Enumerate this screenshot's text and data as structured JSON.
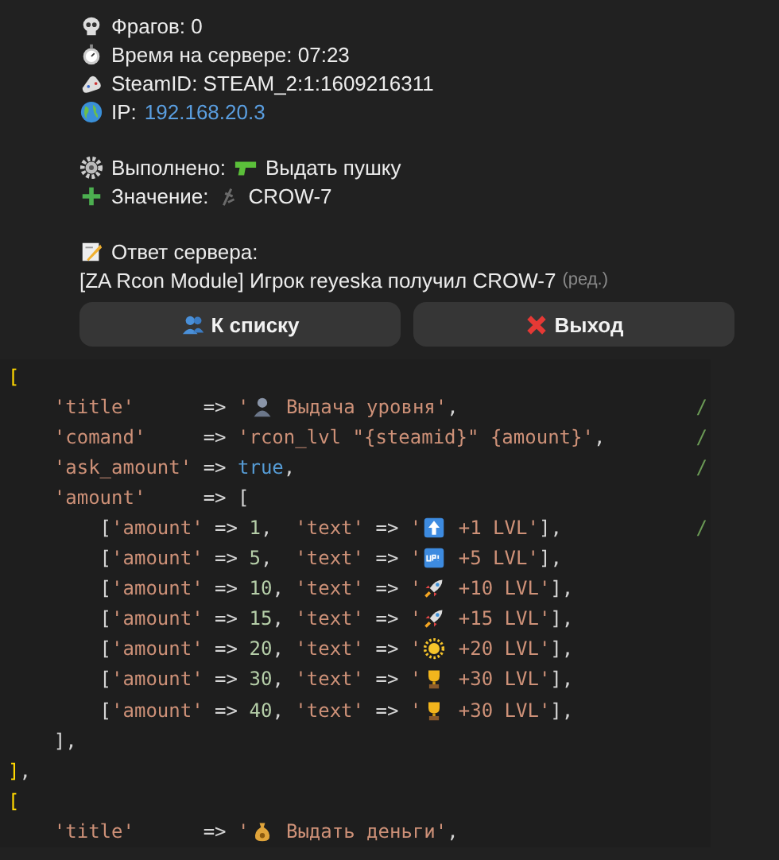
{
  "info_lines": [
    {
      "label": "Фрагов: 0"
    },
    {
      "label": "Время на сервере: 07:23"
    },
    {
      "label": "SteamID: STEAM_2:1:1609216311"
    },
    {
      "label": "IP:",
      "link": "192.168.20.3"
    }
  ],
  "action": {
    "label": "Выполнено:",
    "value": "Выдать пушку"
  },
  "value_line": {
    "label": "Значение:",
    "value": "CROW-7"
  },
  "response": {
    "label": "Ответ сервера:",
    "text": "[ZA Rcon Module] Игрок reyeska получил CROW-7",
    "edited": "(ред.)"
  },
  "buttons": [
    {
      "label": "К списку"
    },
    {
      "label": "Выход"
    }
  ],
  "code": {
    "lines": [
      {
        "tokens": [
          {
            "kind": "outer",
            "text": "["
          }
        ]
      },
      {
        "tokens": [
          {
            "kind": "str",
            "text": "    'title'"
          },
          {
            "kind": "op",
            "text": "      => "
          },
          {
            "kind": "str",
            "text": "'"
          },
          {
            "kind": "emoji"
          },
          {
            "kind": "str",
            "text": " Выдача уровня'"
          },
          {
            "kind": "op",
            "text": ","
          }
        ],
        "comment": "/"
      },
      {
        "tokens": [
          {
            "kind": "str",
            "text": "    'comand'"
          },
          {
            "kind": "op",
            "text": "     => "
          },
          {
            "kind": "str",
            "text": "'rcon_lvl \"{steamid}\" {amount}'"
          },
          {
            "kind": "op",
            "text": ","
          }
        ],
        "comment": "/"
      },
      {
        "tokens": [
          {
            "kind": "str",
            "text": "    'ask_amount'"
          },
          {
            "kind": "op",
            "text": " => "
          },
          {
            "kind": "kw",
            "text": "true"
          },
          {
            "kind": "op",
            "text": ","
          }
        ],
        "comment": "/"
      },
      {
        "tokens": [
          {
            "kind": "str",
            "text": "    'amount'"
          },
          {
            "kind": "op",
            "text": "     => "
          },
          {
            "kind": "inner",
            "text": "["
          }
        ]
      },
      {
        "tokens": [
          {
            "kind": "inner",
            "text": "        ["
          },
          {
            "kind": "str",
            "text": "'amount'"
          },
          {
            "kind": "op",
            "text": " => "
          },
          {
            "kind": "num",
            "text": "1"
          },
          {
            "kind": "op",
            "text": ",  "
          },
          {
            "kind": "str",
            "text": "'text'"
          },
          {
            "kind": "op",
            "text": " => "
          },
          {
            "kind": "str",
            "text": "'"
          },
          {
            "kind": "emoji"
          },
          {
            "kind": "str",
            "text": " +1 LVL'"
          },
          {
            "kind": "inner",
            "text": "]"
          },
          {
            "kind": "op",
            "text": ","
          }
        ],
        "comment": "/"
      },
      {
        "tokens": [
          {
            "kind": "inner",
            "text": "        ["
          },
          {
            "kind": "str",
            "text": "'amount'"
          },
          {
            "kind": "op",
            "text": " => "
          },
          {
            "kind": "num",
            "text": "5"
          },
          {
            "kind": "op",
            "text": ",  "
          },
          {
            "kind": "str",
            "text": "'text'"
          },
          {
            "kind": "op",
            "text": " => "
          },
          {
            "kind": "str",
            "text": "'"
          },
          {
            "kind": "emoji"
          },
          {
            "kind": "str",
            "text": " +5 LVL'"
          },
          {
            "kind": "inner",
            "text": "]"
          },
          {
            "kind": "op",
            "text": ","
          }
        ]
      },
      {
        "tokens": [
          {
            "kind": "inner",
            "text": "        ["
          },
          {
            "kind": "str",
            "text": "'amount'"
          },
          {
            "kind": "op",
            "text": " => "
          },
          {
            "kind": "num",
            "text": "10"
          },
          {
            "kind": "op",
            "text": ", "
          },
          {
            "kind": "str",
            "text": "'text'"
          },
          {
            "kind": "op",
            "text": " => "
          },
          {
            "kind": "str",
            "text": "'"
          },
          {
            "kind": "emoji"
          },
          {
            "kind": "str",
            "text": " +10 LVL'"
          },
          {
            "kind": "inner",
            "text": "]"
          },
          {
            "kind": "op",
            "text": ","
          }
        ]
      },
      {
        "tokens": [
          {
            "kind": "inner",
            "text": "        ["
          },
          {
            "kind": "str",
            "text": "'amount'"
          },
          {
            "kind": "op",
            "text": " => "
          },
          {
            "kind": "num",
            "text": "15"
          },
          {
            "kind": "op",
            "text": ", "
          },
          {
            "kind": "str",
            "text": "'text'"
          },
          {
            "kind": "op",
            "text": " => "
          },
          {
            "kind": "str",
            "text": "'"
          },
          {
            "kind": "emoji"
          },
          {
            "kind": "str",
            "text": " +15 LVL'"
          },
          {
            "kind": "inner",
            "text": "]"
          },
          {
            "kind": "op",
            "text": ","
          }
        ]
      },
      {
        "tokens": [
          {
            "kind": "inner",
            "text": "        ["
          },
          {
            "kind": "str",
            "text": "'amount'"
          },
          {
            "kind": "op",
            "text": " => "
          },
          {
            "kind": "num",
            "text": "20"
          },
          {
            "kind": "op",
            "text": ", "
          },
          {
            "kind": "str",
            "text": "'text'"
          },
          {
            "kind": "op",
            "text": " => "
          },
          {
            "kind": "str",
            "text": "'"
          },
          {
            "kind": "emoji"
          },
          {
            "kind": "str",
            "text": " +20 LVL'"
          },
          {
            "kind": "inner",
            "text": "]"
          },
          {
            "kind": "op",
            "text": ","
          }
        ]
      },
      {
        "tokens": [
          {
            "kind": "inner",
            "text": "        ["
          },
          {
            "kind": "str",
            "text": "'amount'"
          },
          {
            "kind": "op",
            "text": " => "
          },
          {
            "kind": "num",
            "text": "30"
          },
          {
            "kind": "op",
            "text": ", "
          },
          {
            "kind": "str",
            "text": "'text'"
          },
          {
            "kind": "op",
            "text": " => "
          },
          {
            "kind": "str",
            "text": "'"
          },
          {
            "kind": "emoji"
          },
          {
            "kind": "str",
            "text": " +30 LVL'"
          },
          {
            "kind": "inner",
            "text": "]"
          },
          {
            "kind": "op",
            "text": ","
          }
        ]
      },
      {
        "tokens": [
          {
            "kind": "inner",
            "text": "        ["
          },
          {
            "kind": "str",
            "text": "'amount'"
          },
          {
            "kind": "op",
            "text": " => "
          },
          {
            "kind": "num",
            "text": "40"
          },
          {
            "kind": "op",
            "text": ", "
          },
          {
            "kind": "str",
            "text": "'text'"
          },
          {
            "kind": "op",
            "text": " => "
          },
          {
            "kind": "str",
            "text": "'"
          },
          {
            "kind": "emoji"
          },
          {
            "kind": "str",
            "text": " +30 LVL'"
          },
          {
            "kind": "inner",
            "text": "]"
          },
          {
            "kind": "op",
            "text": ","
          }
        ]
      },
      {
        "tokens": [
          {
            "kind": "inner",
            "text": "    ]"
          },
          {
            "kind": "op",
            "text": ","
          }
        ]
      },
      {
        "tokens": [
          {
            "kind": "outer",
            "text": "]"
          },
          {
            "kind": "op",
            "text": ","
          }
        ]
      },
      {
        "tokens": [
          {
            "kind": "outer",
            "text": "["
          }
        ]
      },
      {
        "tokens": [
          {
            "kind": "str",
            "text": "    'title'"
          },
          {
            "kind": "op",
            "text": "      => "
          },
          {
            "kind": "str",
            "text": "'"
          },
          {
            "kind": "emoji"
          },
          {
            "kind": "str",
            "text": " Выдать деньги'"
          },
          {
            "kind": "op",
            "text": ","
          }
        ]
      }
    ]
  }
}
